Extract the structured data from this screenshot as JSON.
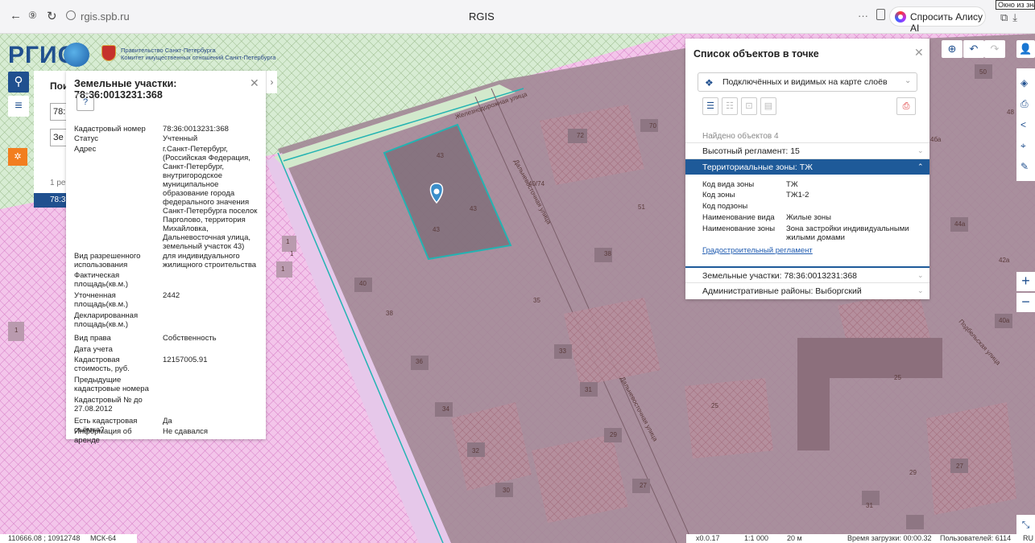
{
  "browser": {
    "url": "rgis.spb.ru",
    "title": "RGIS",
    "dots": "···",
    "alisa": "Спросить Алису AI",
    "tooltip": "Окно из значе"
  },
  "header": {
    "logo": "РГИС",
    "gov_line1": "Правительство Санкт-Петербурга",
    "gov_line2": "Комитет имущественных отношений Санкт-Петербурга"
  },
  "search_panel": {
    "title_fragment": "Пои",
    "field1": "78:",
    "field2": "Зе",
    "results_fragment": "1 ре",
    "selected_fragment": "78:3"
  },
  "parcel": {
    "title": "Земельные участки: 78:36:0013231:368",
    "doc_icon": "?",
    "rows": [
      {
        "k": "Кадастровый номер",
        "v": "78:36:0013231:368"
      },
      {
        "k": "Статус",
        "v": "Учтенный"
      },
      {
        "k": "Адрес",
        "v": "г.Санкт-Петербург, (Российская Федерация, Санкт-Петербург, внутригородское муниципальное образование города федерального значения Санкт-Петербурга поселок Парголово, территория Михайловка, Дальневосточная улица, земельный участок 43)"
      },
      {
        "k": "Вид разрешенного использования",
        "v": "для индивидуального жилищного строительства"
      },
      {
        "k": "Фактическая площадь(кв.м.)",
        "v": ""
      },
      {
        "k": "Уточненная площадь(кв.м.)",
        "v": "2442"
      },
      {
        "k": "Декларированная площадь(кв.м.)",
        "v": ""
      },
      {
        "k": "Вид права",
        "v": "Собственность"
      },
      {
        "k": "Дата учета",
        "v": ""
      },
      {
        "k": "Кадастровая стоимость, руб.",
        "v": "12157005.91"
      },
      {
        "k": "Предыдущие кадастровые номера",
        "v": ""
      },
      {
        "k": "Кадастровый № до 27.08.2012",
        "v": ""
      },
      {
        "k": "Есть кадастровая съёмка?",
        "v": "Да"
      },
      {
        "k": "Информация об аренде",
        "v": "Не сдавался"
      }
    ]
  },
  "objects": {
    "title": "Список объектов в точке",
    "layer_select": "Подключённых и видимых на карте слоёв",
    "found": "Найдено объектов 4",
    "rows": [
      "Высотный регламент: 15",
      "Территориальные зоны: ТЖ",
      "Земельные участки: 78:36:0013231:368",
      "Административные районы: Выборгский"
    ],
    "zone_attrs": [
      {
        "k": "Код вида зоны",
        "v": "ТЖ"
      },
      {
        "k": "Код зоны",
        "v": "ТЖ1-2"
      },
      {
        "k": "Код подзоны",
        "v": ""
      },
      {
        "k": "Наименование вида",
        "v": "Жилые зоны"
      },
      {
        "k": "Наименование зоны",
        "v": "Зона застройки индивидуальными жилыми домами"
      }
    ],
    "link": "Градостроительный регламент"
  },
  "map": {
    "street1": "Дальневосточная улица",
    "street2": "Дальневосточная улица",
    "street3": "Подбельская улица",
    "street_top": "Железнодорожная улица",
    "labels": [
      "43",
      "43",
      "43",
      "70",
      "72",
      "40/74",
      "51",
      "50",
      "48",
      "38",
      "40",
      "38",
      "35",
      "33",
      "36",
      "31",
      "34",
      "29",
      "32",
      "30",
      "27",
      "25",
      "25",
      "44а",
      "42а",
      "40а",
      "1",
      "1",
      "1",
      "1",
      "27",
      "29",
      "31",
      "31",
      "4ба"
    ]
  },
  "status": {
    "coords": "110666.08 ; 10912748",
    "crs": "МСК-64",
    "scale_val": "x0.0.17",
    "scale": "1:1 000",
    "dist": "20 м",
    "load_time": "Время загрузки: 00:00.32",
    "users": "Пользователей: 6114",
    "more": "RU"
  },
  "colors": {
    "brand": "#20508f",
    "highlight": "#23b3b2",
    "zone_active": "#1e5a99"
  }
}
